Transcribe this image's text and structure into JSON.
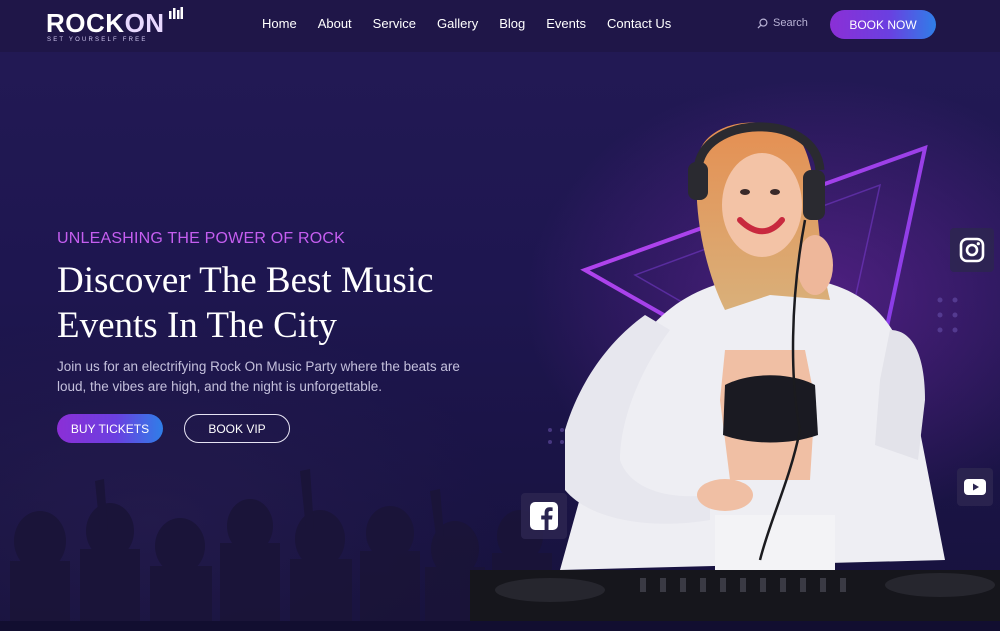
{
  "brand": {
    "logo_rock": "ROCK",
    "logo_on": "ON",
    "tagline": "SET YOURSELF FREE"
  },
  "nav": {
    "items": [
      {
        "label": "Home"
      },
      {
        "label": "About"
      },
      {
        "label": "Service"
      },
      {
        "label": "Gallery"
      },
      {
        "label": "Blog"
      },
      {
        "label": "Events"
      },
      {
        "label": "Contact Us"
      }
    ]
  },
  "search": {
    "label": "Search",
    "icon": "search-icon"
  },
  "header": {
    "cta_label": "BOOK NOW"
  },
  "hero": {
    "eyebrow": "UNLEASHING THE POWER OF ROCK",
    "title_line1": "Discover The Best Music",
    "title_line2": "Events In The City",
    "description": "Join us for an electrifying Rock On Music Party where the beats are loud, the vibes are high, and the night is unforgettable.",
    "primary_button": "BUY TICKETS",
    "secondary_button": "BOOK VIP"
  },
  "social": {
    "facebook_icon": "facebook-icon",
    "instagram_icon": "instagram-icon",
    "youtube_icon": "youtube-icon"
  },
  "colors": {
    "accent_purple": "#8b2fd6",
    "accent_blue": "#2f7ee8",
    "eyebrow": "#c55ef0",
    "background": "#1e1650"
  }
}
